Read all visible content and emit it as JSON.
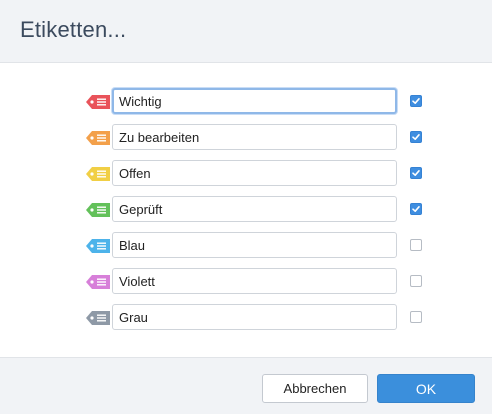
{
  "dialog": {
    "title": "Etiketten...",
    "labels": [
      {
        "name": "Wichtig",
        "color": "#e9535a",
        "checked": true,
        "focused": true
      },
      {
        "name": "Zu bearbeiten",
        "color": "#f3a04a",
        "checked": true,
        "focused": false
      },
      {
        "name": "Offen",
        "color": "#f1cf45",
        "checked": true,
        "focused": false
      },
      {
        "name": "Geprüft",
        "color": "#63c15a",
        "checked": true,
        "focused": false
      },
      {
        "name": "Blau",
        "color": "#4db3ea",
        "checked": false,
        "focused": false
      },
      {
        "name": "Violett",
        "color": "#d77fd9",
        "checked": false,
        "focused": false
      },
      {
        "name": "Grau",
        "color": "#8e99a6",
        "checked": false,
        "focused": false
      }
    ],
    "buttons": {
      "cancel": "Abbrechen",
      "ok": "OK"
    },
    "colors": {
      "accent": "#3b8fdc",
      "header_bg": "#f1f3f6"
    }
  }
}
